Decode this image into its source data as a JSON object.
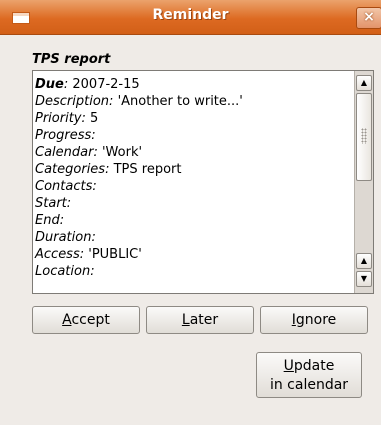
{
  "window": {
    "title": "Reminder",
    "close_glyph": "×"
  },
  "section_title": "TPS report",
  "details": [
    {
      "key": "Due",
      "sep": ": ",
      "value": "2007-2-15",
      "bold": true
    },
    {
      "key": "Description",
      "sep": ": ",
      "value": "'Another to write...'",
      "bold": false
    },
    {
      "key": "Priority",
      "sep": ": ",
      "value": "5",
      "bold": false
    },
    {
      "key": "Progress",
      "sep": ":",
      "value": "",
      "bold": false
    },
    {
      "key": "Calendar",
      "sep": ": ",
      "value": "'Work'",
      "bold": false
    },
    {
      "key": "Categories",
      "sep": ": ",
      "value": "TPS report",
      "bold": false
    },
    {
      "key": "Contacts",
      "sep": ":",
      "value": "",
      "bold": false
    },
    {
      "key": "Start",
      "sep": ":",
      "value": "",
      "bold": false
    },
    {
      "key": "End",
      "sep": ":",
      "value": "",
      "bold": false
    },
    {
      "key": "Duration",
      "sep": ":",
      "value": "",
      "bold": false
    },
    {
      "key": "Access",
      "sep": ": ",
      "value": "'PUBLIC'",
      "bold": false
    },
    {
      "key": "Location",
      "sep": ":",
      "value": "",
      "bold": false
    }
  ],
  "buttons": {
    "accept": {
      "mnemonic": "A",
      "rest": "ccept"
    },
    "later": {
      "mnemonic": "L",
      "rest": "ater"
    },
    "ignore": {
      "mnemonic": "I",
      "rest": "gnore"
    },
    "update": {
      "mnemonic": "U",
      "rest": "pdate",
      "line2": "in calendar"
    }
  },
  "icons": {
    "window_icon": "window-icon",
    "close": "close-icon",
    "scroll_up": "arrow-up-icon",
    "scroll_down": "arrow-down-icon"
  }
}
